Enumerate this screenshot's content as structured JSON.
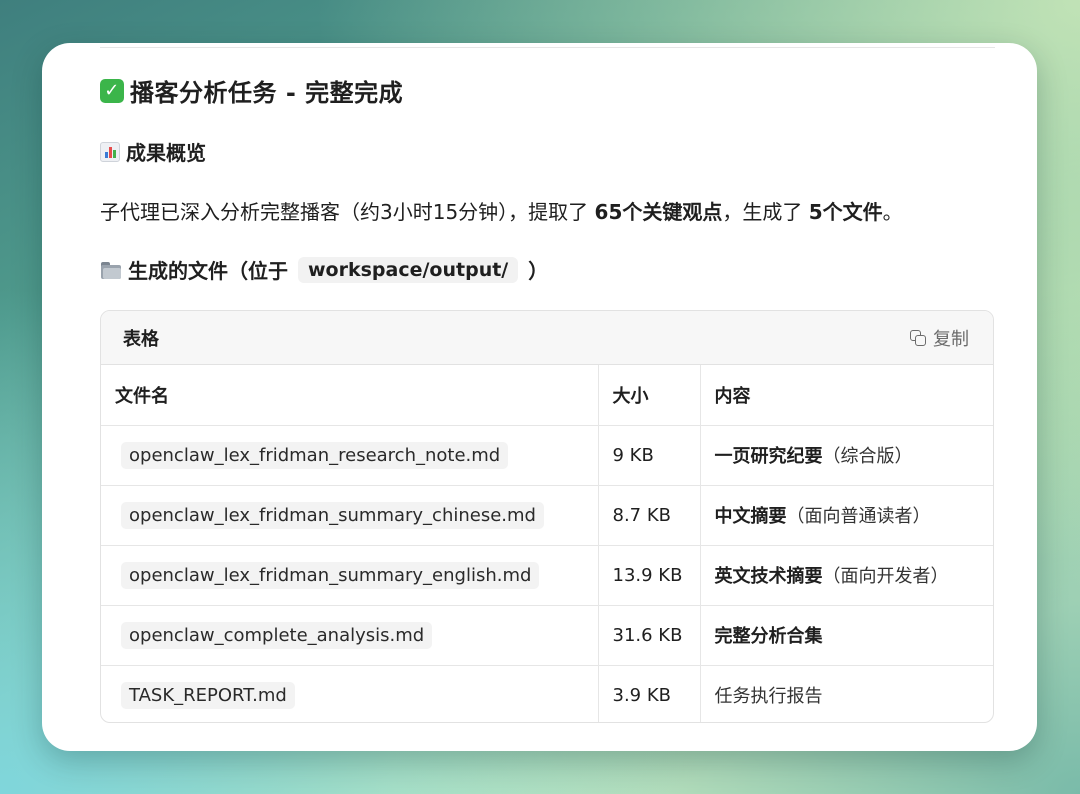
{
  "title": {
    "icon": "check-mark-icon",
    "text": "播客分析任务 - 完整完成"
  },
  "overview": {
    "icon": "bar-chart-icon",
    "heading": "成果概览",
    "paragraph": {
      "part1": "子代理已深入分析完整播客（约3小时15分钟），提取了 ",
      "bold1": "65个关键观点",
      "part2": "，生成了 ",
      "bold2": "5个文件",
      "part3": "。"
    }
  },
  "files_section": {
    "icon": "folder-icon",
    "heading_prefix": "生成的文件（位于",
    "path": "workspace/output/",
    "heading_suffix": "）"
  },
  "table": {
    "title": "表格",
    "copy_label": "复制",
    "headers": {
      "name": "文件名",
      "size": "大小",
      "desc": "内容"
    },
    "rows": [
      {
        "name": "openclaw_lex_fridman_research_note.md",
        "size": "9 KB",
        "desc_bold": "一页研究纪要",
        "desc_rest": "（综合版）"
      },
      {
        "name": "openclaw_lex_fridman_summary_chinese.md",
        "size": "8.7 KB",
        "desc_bold": "中文摘要",
        "desc_rest": "（面向普通读者）"
      },
      {
        "name": "openclaw_lex_fridman_summary_english.md",
        "size": "13.9 KB",
        "desc_bold": "英文技术摘要",
        "desc_rest": "（面向开发者）"
      },
      {
        "name": "openclaw_complete_analysis.md",
        "size": "31.6 KB",
        "desc_bold": "完整分析合集",
        "desc_rest": ""
      },
      {
        "name": "TASK_REPORT.md",
        "size": "3.9 KB",
        "desc_bold": "",
        "desc_rest": "任务执行报告"
      }
    ]
  }
}
